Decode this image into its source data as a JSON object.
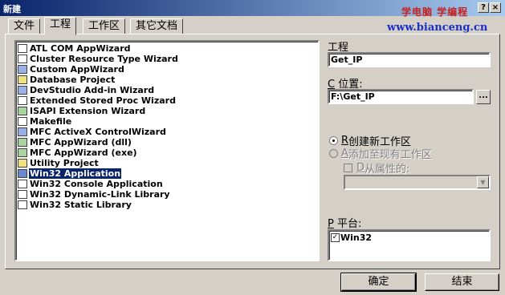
{
  "window": {
    "title": "新建",
    "help_glyph": "?",
    "close_glyph": "×",
    "watermark_line1": "学电脑 学编程",
    "watermark_line2": "www.bianceng.cn"
  },
  "tabs": [
    {
      "label": "文件",
      "active": false
    },
    {
      "label": "工程",
      "active": true
    },
    {
      "label": "工作区",
      "active": false
    },
    {
      "label": "其它文档",
      "active": false
    }
  ],
  "project_types": [
    {
      "label": "ATL COM AppWizard",
      "icon": "atl-wizard-icon",
      "selected": false
    },
    {
      "label": "Cluster Resource Type Wizard",
      "icon": "cluster-wizard-icon",
      "selected": false
    },
    {
      "label": "Custom AppWizard",
      "icon": "custom-wizard-icon",
      "selected": false
    },
    {
      "label": "Database Project",
      "icon": "database-icon",
      "selected": false
    },
    {
      "label": "DevStudio Add-in Wizard",
      "icon": "addin-wizard-icon",
      "selected": false
    },
    {
      "label": "Extended Stored Proc Wizard",
      "icon": "stored-proc-icon",
      "selected": false
    },
    {
      "label": "ISAPI Extension Wizard",
      "icon": "isapi-icon",
      "selected": false
    },
    {
      "label": "Makefile",
      "icon": "makefile-icon",
      "selected": false
    },
    {
      "label": "MFC ActiveX ControlWizard",
      "icon": "activex-icon",
      "selected": false
    },
    {
      "label": "MFC AppWizard (dll)",
      "icon": "mfc-dll-icon",
      "selected": false
    },
    {
      "label": "MFC AppWizard (exe)",
      "icon": "mfc-exe-icon",
      "selected": false
    },
    {
      "label": "Utility Project",
      "icon": "utility-icon",
      "selected": false
    },
    {
      "label": "Win32 Application",
      "icon": "win32-app-icon",
      "selected": true
    },
    {
      "label": "Win32 Console Application",
      "icon": "console-app-icon",
      "selected": false
    },
    {
      "label": "Win32 Dynamic-Link Library",
      "icon": "dll-icon",
      "selected": false
    },
    {
      "label": "Win32 Static Library",
      "icon": "static-lib-icon",
      "selected": false
    }
  ],
  "project_name": {
    "label": "工程",
    "value": "Get_IP"
  },
  "location": {
    "accel": "C",
    "label": " 位置:",
    "value": "F:\\Get_IP",
    "browse_label": "..."
  },
  "workspace_options": {
    "create_new": {
      "accel": "R",
      "label": " 创建新工作区",
      "checked": true
    },
    "add_to_current": {
      "accel": "A",
      "label": " 添加至现有工作区",
      "checked": false,
      "disabled": true
    },
    "dependency": {
      "accel": "D",
      "label": " 从属性的:",
      "disabled": true
    }
  },
  "platforms": {
    "accel": "P",
    "label": " 平台:",
    "items": [
      {
        "label": "Win32",
        "checked": true,
        "check_glyph": "✓"
      }
    ]
  },
  "buttons": {
    "ok": "确定",
    "cancel": "结束"
  }
}
